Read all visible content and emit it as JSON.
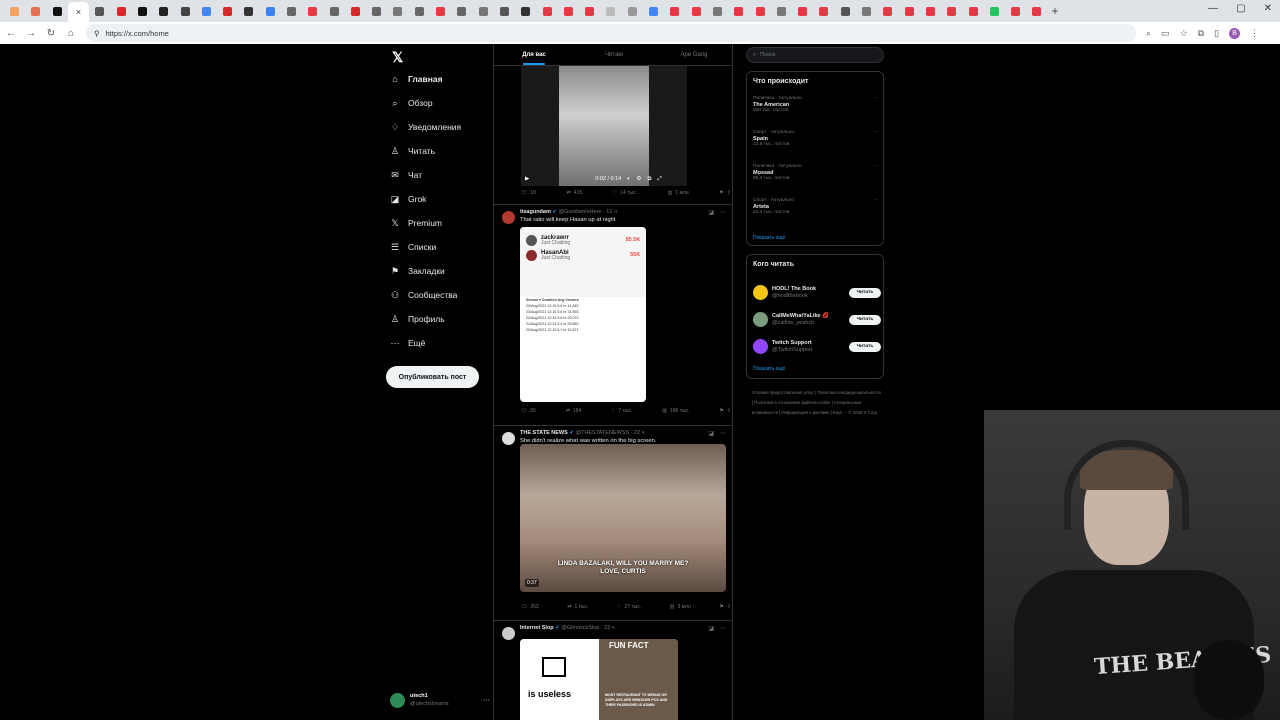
{
  "browser": {
    "active_tab_close": "×",
    "new_tab": "+",
    "url": "https://x.com/home",
    "tab_colors": [
      "#f4a261",
      "#e76f51",
      "#111",
      "#2a9d8f",
      "#555",
      "#d62828",
      "#111",
      "#222",
      "#444",
      "#4285f4",
      "#d62828",
      "#333",
      "#3b82f6",
      "#666",
      "#e63946",
      "#666",
      "#d62828",
      "#666",
      "#777",
      "#666",
      "#e63946",
      "#666",
      "#777",
      "#555",
      "#333",
      "#e63946",
      "#e63946",
      "#e63946",
      "#bbb",
      "#999",
      "#4285f4",
      "#e63946",
      "#e63946",
      "#777",
      "#e63946",
      "#e63946",
      "#777",
      "#e63946",
      "#e63946",
      "#555",
      "#777",
      "#e63946",
      "#e63946",
      "#e63946",
      "#e63946",
      "#e63946",
      "#22c55e",
      "#e63946",
      "#e63946"
    ],
    "window_controls": [
      "—",
      "▢",
      "✕"
    ],
    "profile_initial": "B"
  },
  "sidebar": {
    "logo": "𝕏",
    "items": [
      {
        "label": "Главная",
        "icon": "⌂"
      },
      {
        "label": "Обзор",
        "icon": "⌕"
      },
      {
        "label": "Уведомления",
        "icon": "♢"
      },
      {
        "label": "Читать",
        "icon": "♙"
      },
      {
        "label": "Чат",
        "icon": "✉"
      },
      {
        "label": "Grok",
        "icon": "◪"
      },
      {
        "label": "Premium",
        "icon": "𝕏"
      },
      {
        "label": "Списки",
        "icon": "☰"
      },
      {
        "label": "Закладки",
        "icon": "⚑"
      },
      {
        "label": "Сообщества",
        "icon": "⚇"
      },
      {
        "label": "Профиль",
        "icon": "♙"
      },
      {
        "label": "Ещё",
        "icon": "⋯"
      }
    ],
    "post_button": "Опубликовать пост",
    "account": {
      "name": "utech1",
      "handle": "@utechstreams",
      "more": "···"
    }
  },
  "feed": {
    "tabs": [
      "Для вас",
      "Читаю",
      "Ape Gang"
    ],
    "video1": {
      "time": "0:02 / 0:14"
    },
    "actions1": [
      "10",
      "415",
      "14 тыс.",
      "1 млн"
    ],
    "post1": {
      "name": "itsagundam",
      "handle": "@GundamIsHere · 12 ч",
      "text": "That ratio will keep Hasan up at night",
      "streamers": [
        {
          "name": "zackrawrr",
          "status": "Just Chatting",
          "count": "85.5K"
        },
        {
          "name": "HasanAbi",
          "status": "Just Chatting",
          "count": "55K"
        }
      ],
      "table_header": "Stream ▾        Duration   Avg Viewers",
      "table_rows": [
        "29/Aug/2021 12:15    5.8 hr    41,849",
        "23/Aug/2021 12:16    5.8 hr    34,563",
        "22/Aug/2021 12:34    5.8 hr    29,079",
        "21/Aug/2021 12:31    5.4 hr    25,882",
        "20/Aug/2021 12:15    5.1 hr    42,871"
      ],
      "actions": [
        "55",
        "184",
        "7 тыс.",
        "186 тыс."
      ]
    },
    "post2": {
      "name": "THE STATE NEWS",
      "handle": "@THESTATENEWSS · 22 ч",
      "text": "She didn't realize what was written on the big screen.",
      "caption": "LINDA BAZALAKI, WILL YOU MARRY ME?\nLOVE, CURTIS",
      "duration": "0:37",
      "actions": [
        "263",
        "1 тыс.",
        "27 тыс.",
        "3 млн"
      ]
    },
    "post3": {
      "name": "Internet Slop",
      "handle": "@GimmickSlop · 22 ч",
      "meme_left": "is useless",
      "meme_right_title": "FUN FACT",
      "meme_right_text": "MOST RESTAURANT TV MENUS OR DISPLAYS ARE WINDOWS PCS AND THEIR PASSWORD IS ADMIN"
    }
  },
  "right": {
    "search_placeholder": "Поиск",
    "trends_title": "Что происходит",
    "trends": [
      {
        "meta": "Политика · Актуально",
        "title": "The American",
        "count": "600 тыс. постов"
      },
      {
        "meta": "Спорт · Актуально",
        "title": "Spain",
        "count": "22,9 тыс. постов"
      },
      {
        "meta": "Политика · Актуально",
        "title": "Mossad",
        "count": "86,4 тыс. постов"
      },
      {
        "meta": "Спорт · Актуально",
        "title": "Arteta",
        "count": "24,4 тыс. постов"
      }
    ],
    "show_more": "Показать ещё",
    "who_title": "Кого читать",
    "who": [
      {
        "name": "HODL! The Book",
        "handle": "@hodlthebook",
        "btn": "Читать",
        "color": "#f5c518"
      },
      {
        "name": "CallMeWhatYaLike 💋",
        "handle": "@callme_yeahch",
        "btn": "Читать",
        "color": "#7a9e7e"
      },
      {
        "name": "Twitch Support",
        "handle": "@TwitchSupport",
        "btn": "Читать",
        "color": "#9146ff"
      }
    ],
    "show_more2": "Показать ещё",
    "footer": "Условия предоставления услуг | Политика конфиденциальности | Политика в отношении файлов cookie | Специальные возможности | Информация о рекламе | Ещё ··· © 2025 X Corp."
  },
  "webcam": {
    "shirt_text": "THE BEATLES"
  },
  "colors": {
    "accent": "#1d9bf0",
    "bg": "#000000",
    "border": "#2f3336",
    "muted": "#71767b"
  }
}
